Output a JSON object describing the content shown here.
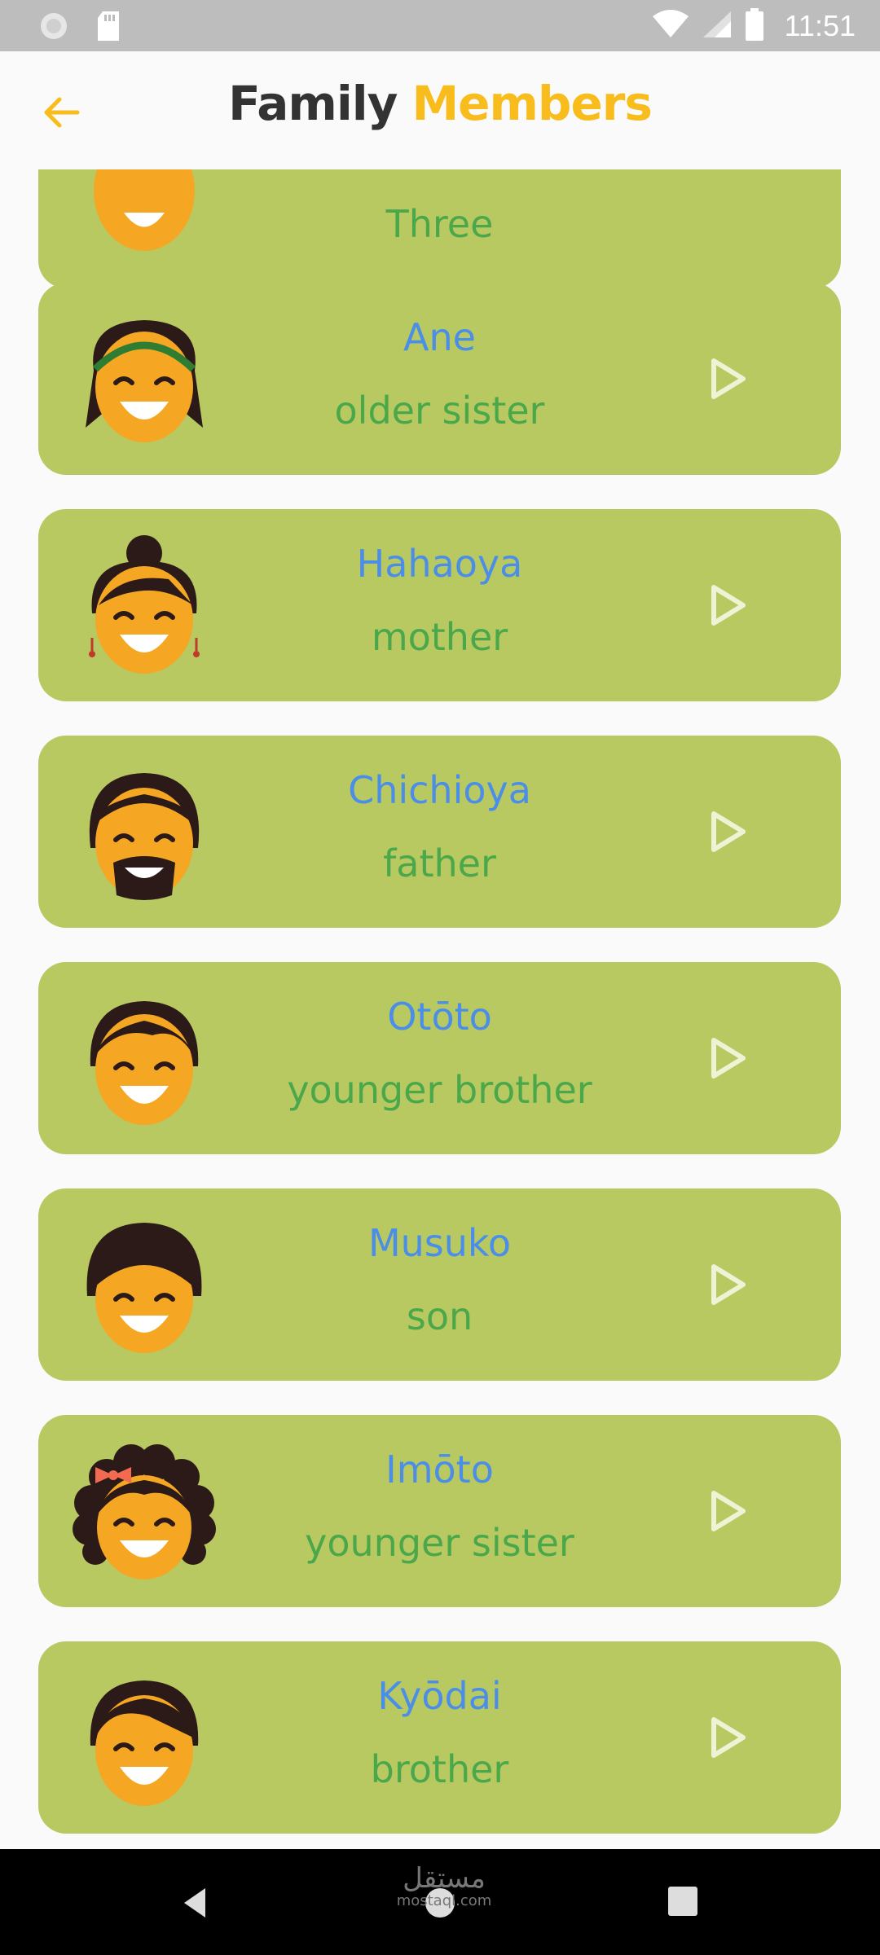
{
  "status_bar": {
    "time": "11:51"
  },
  "header": {
    "title_part1": "Family",
    "title_part2": "Members",
    "accent": "#f8bc1c"
  },
  "colors": {
    "card": "#b8c962",
    "word": "#4a8ee8",
    "meaning": "#4ba84a",
    "skin": "#f5a623",
    "hair": "#2b1a17"
  },
  "partial_card": {
    "meaning": "Three"
  },
  "cards": [
    {
      "word": "Ane",
      "meaning": "older sister",
      "icon": "older-sister-face-icon"
    },
    {
      "word": "Hahaoya",
      "meaning": "mother",
      "icon": "mother-face-icon"
    },
    {
      "word": "Chichioya",
      "meaning": "father",
      "icon": "father-face-icon"
    },
    {
      "word": "Otōto",
      "meaning": "younger brother",
      "icon": "younger-brother-face-icon"
    },
    {
      "word": "Musuko",
      "meaning": "son",
      "icon": "son-face-icon"
    },
    {
      "word": "Imōto",
      "meaning": "younger sister",
      "icon": "younger-sister-face-icon"
    },
    {
      "word": "Kyōdai",
      "meaning": "brother",
      "icon": "brother-face-icon"
    }
  ],
  "watermark": {
    "line1": "مستقل",
    "line2": "mostaql.com"
  }
}
